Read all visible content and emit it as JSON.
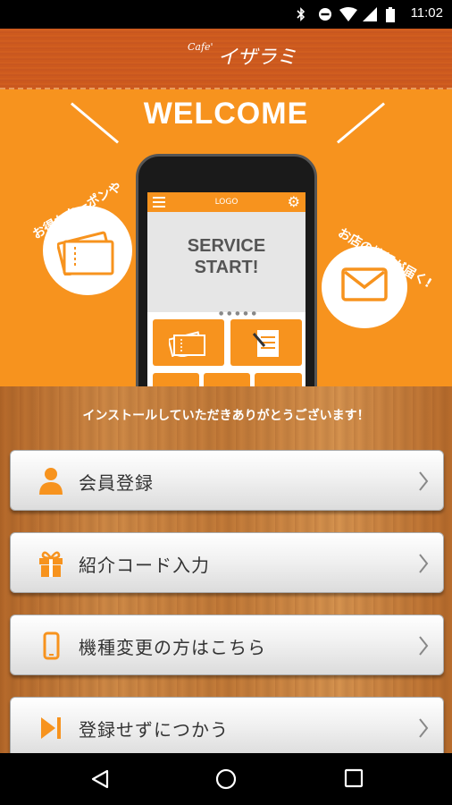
{
  "status_bar": {
    "time": "11:02"
  },
  "header": {
    "logo_small": "Cafe'",
    "logo_main": "イザラミ"
  },
  "hero": {
    "welcome": "WELCOME",
    "left_bubble_text": "お得なクーポンや",
    "right_bubble_text": "お店の情報が届く!",
    "phone": {
      "logo": "LOGO",
      "service_line1": "SERVICE",
      "service_line2": "START!"
    }
  },
  "thanks": "インストールしていただきありがとうございます！",
  "buttons": [
    {
      "label": "会員登録",
      "icon": "person-icon"
    },
    {
      "label": "紹介コード入力",
      "icon": "gift-icon"
    },
    {
      "label": "機種変更の方はこちら",
      "icon": "smartphone-icon"
    },
    {
      "label": "登録せずにつかう",
      "icon": "skip-icon"
    }
  ],
  "colors": {
    "accent": "#f7931e",
    "header": "#cd5b1e"
  }
}
